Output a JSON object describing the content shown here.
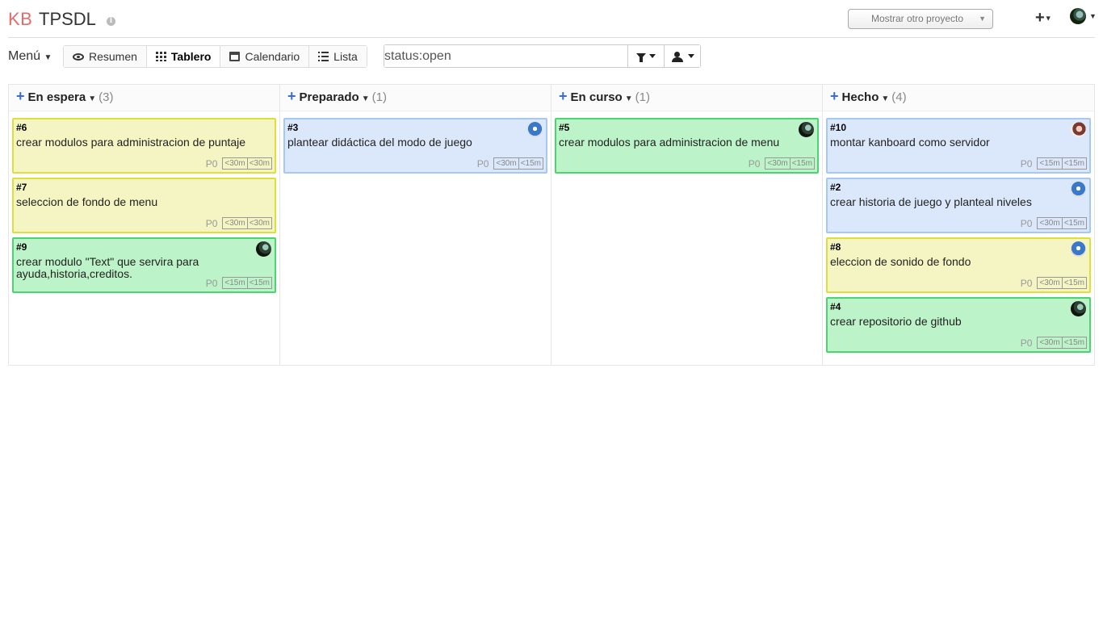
{
  "header": {
    "logo": "KB",
    "project_title": "TPSDL",
    "project_switcher": "Mostrar otro proyecto",
    "plus_label": "+"
  },
  "toolbar": {
    "menu_label": "Menú",
    "views": [
      {
        "label": "Resumen",
        "icon": "eye-icon",
        "active": false
      },
      {
        "label": "Tablero",
        "icon": "grid-icon",
        "active": true
      },
      {
        "label": "Calendario",
        "icon": "calendar-icon",
        "active": false
      },
      {
        "label": "Lista",
        "icon": "list-icon",
        "active": false
      }
    ],
    "search_value": "status:open"
  },
  "columns": [
    {
      "title": "En espera",
      "count": "(3)",
      "tasks": [
        {
          "id": "#6",
          "title": "crear modulos para administracion de puntaje",
          "color": "yellow",
          "priority": "P0",
          "time_estimated": "<30m",
          "time_spent": "<30m",
          "avatar": null
        },
        {
          "id": "#7",
          "title": "seleccion de fondo de menu",
          "color": "yellow",
          "priority": "P0",
          "time_estimated": "<30m",
          "time_spent": "<30m",
          "avatar": null
        },
        {
          "id": "#9",
          "title": "crear modulo \"Text\" que servira para ayuda,historia,creditos.",
          "color": "green",
          "priority": "P0",
          "time_estimated": "<15m",
          "time_spent": "<15m",
          "avatar": "dark"
        }
      ]
    },
    {
      "title": "Preparado",
      "count": "(1)",
      "tasks": [
        {
          "id": "#3",
          "title": "plantear didáctica del modo de juego",
          "color": "blue",
          "priority": "P0",
          "time_estimated": "<30m",
          "time_spent": "<15m",
          "avatar": "blue"
        }
      ]
    },
    {
      "title": "En curso",
      "count": "(1)",
      "tasks": [
        {
          "id": "#5",
          "title": "crear modulos para administracion de menu",
          "color": "green",
          "priority": "P0",
          "time_estimated": "<30m",
          "time_spent": "<15m",
          "avatar": "dark"
        }
      ]
    },
    {
      "title": "Hecho",
      "count": "(4)",
      "tasks": [
        {
          "id": "#10",
          "title": "montar kanboard como servidor",
          "color": "blue",
          "priority": "P0",
          "time_estimated": "<15m",
          "time_spent": "<15m",
          "avatar": "girl"
        },
        {
          "id": "#2",
          "title": "crear historia de juego y planteal niveles",
          "color": "blue",
          "priority": "P0",
          "time_estimated": "<30m",
          "time_spent": "<15m",
          "avatar": "blue"
        },
        {
          "id": "#8",
          "title": "eleccion de sonido de fondo",
          "color": "yellow",
          "priority": "P0",
          "time_estimated": "<30m",
          "time_spent": "<15m",
          "avatar": "blue"
        },
        {
          "id": "#4",
          "title": "crear repositorio de github",
          "color": "green",
          "priority": "P0",
          "time_estimated": "<30m",
          "time_spent": "<15m",
          "avatar": "dark"
        }
      ]
    }
  ],
  "colors": {
    "yellow_bg": "#f5f5c3",
    "yellow_border": "#dfdf3a",
    "blue_bg": "#dbe8fb",
    "blue_border": "#a7c8f0",
    "green_bg": "#bdf3c8",
    "green_border": "#4ad571",
    "logo_red": "#e36c6c",
    "add_blue": "#3a6fc4"
  }
}
